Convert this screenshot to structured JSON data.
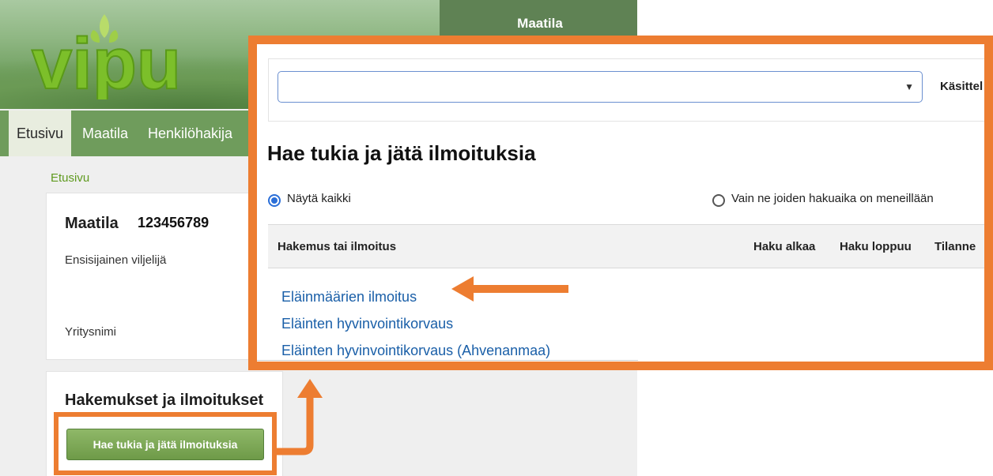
{
  "brand": {
    "logo_text": "vipu",
    "header_label": "Maatila"
  },
  "nav": {
    "items": [
      {
        "label": "Etusivu",
        "active": true
      },
      {
        "label": "Maatila",
        "active": false
      },
      {
        "label": "Henkilöhakija",
        "active": false
      }
    ]
  },
  "breadcrumb": "Etusivu",
  "farm": {
    "title": "Maatila",
    "id": "123456789",
    "role": "Ensisijainen viljelijä",
    "company_label": "Yritysnimi"
  },
  "applications": {
    "title": "Hakemukset ja ilmoitukset",
    "button_label": "Hae tukia ja jätä ilmoituksia"
  },
  "zoom": {
    "select": {
      "value": ""
    },
    "handler_label": "Käsittel",
    "title": "Hae tukia ja jätä ilmoituksia",
    "filters": [
      {
        "label": "Näytä kaikki",
        "selected": true
      },
      {
        "label": "Vain ne joiden hakuaika on meneillään",
        "selected": false
      }
    ],
    "table": {
      "headers": [
        "Hakemus tai ilmoitus",
        "Haku alkaa",
        "Haku loppuu",
        "Tilanne"
      ],
      "rows": [
        "Eläinmäärien ilmoitus",
        "Eläinten hyvinvointikorvaus",
        "Eläinten hyvinvointikorvaus (Ahvenanmaa)"
      ]
    }
  },
  "colors": {
    "highlight": "#ed7d31",
    "nav_green": "#6f9c5c",
    "link_blue": "#1a5fa8",
    "radio_blue": "#2b6fd8",
    "button_green": "#7aa652"
  }
}
